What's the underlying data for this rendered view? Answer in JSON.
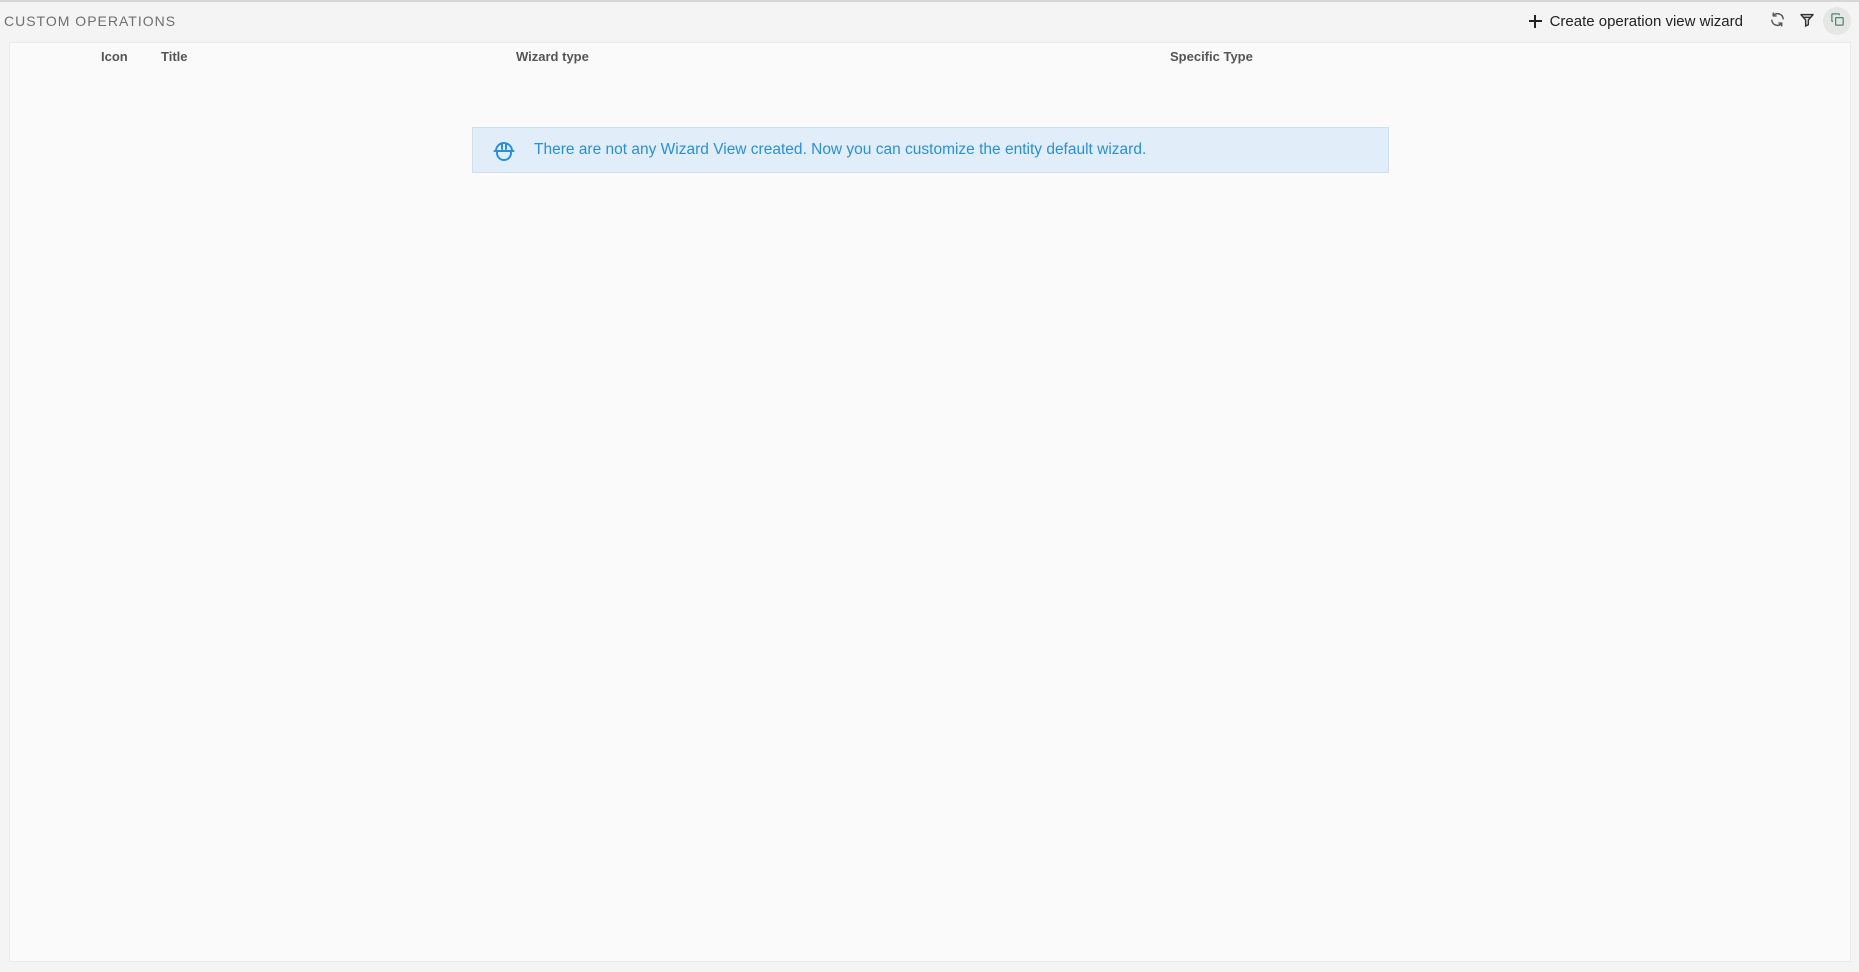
{
  "header": {
    "title": "CUSTOM OPERATIONS",
    "create_label": "Create operation view wizard"
  },
  "table": {
    "columns": [
      "Icon",
      "Title",
      "Wizard type",
      "Specific Type"
    ]
  },
  "empty_state": {
    "message": "There are not any Wizard View created. Now you can customize the entity default wizard."
  },
  "icons": {
    "create": "plus-icon",
    "refresh": "refresh-icon",
    "filter": "filter-icon",
    "copy": "copy-icon",
    "notice": "hard-hat-icon"
  },
  "colors": {
    "accent": "#2a8fd6",
    "notice_bg": "#e1eef9"
  }
}
